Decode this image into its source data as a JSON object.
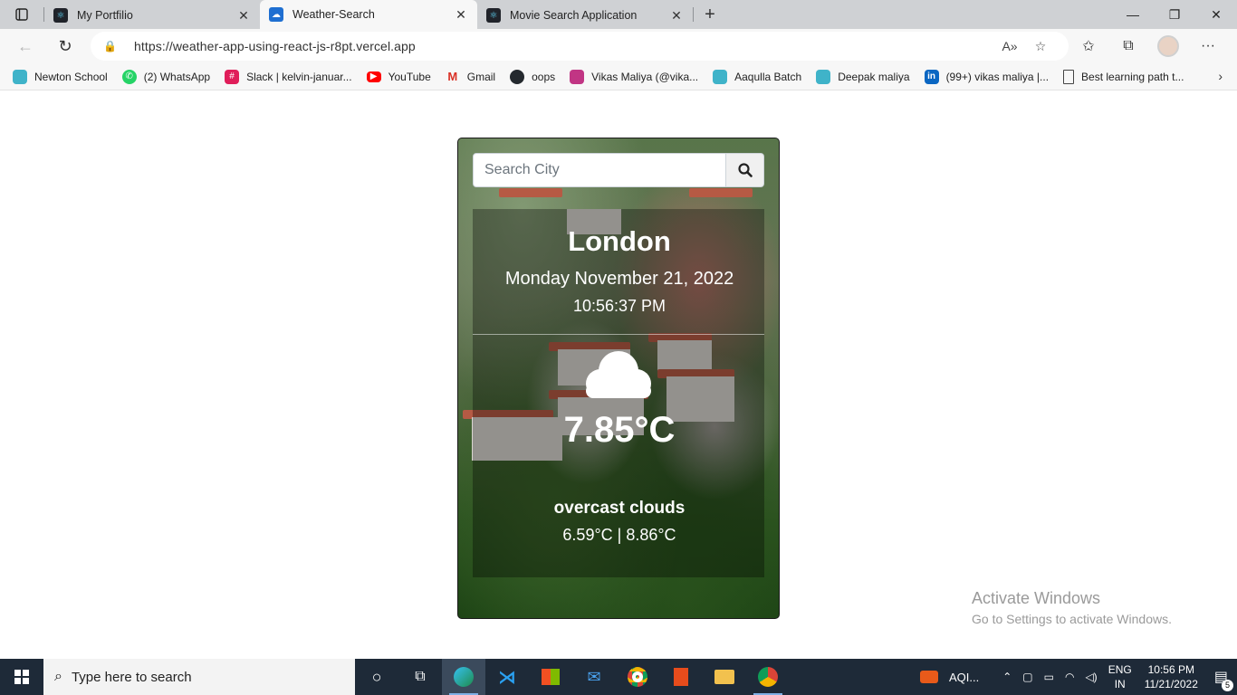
{
  "browser": {
    "tabs": [
      {
        "title": "My Portfilio",
        "active": false,
        "favicon_color": "#20232a"
      },
      {
        "title": "Weather-Search",
        "active": true,
        "favicon_color": "#1f6fd1"
      },
      {
        "title": "Movie Search Application",
        "active": false,
        "favicon_color": "#20232a"
      }
    ],
    "url": "https://weather-app-using-react-js-r8pt.vercel.app"
  },
  "bookmarks": [
    {
      "label": "Newton School",
      "icon": "newton-icon",
      "color": "#3fb3c9"
    },
    {
      "label": "(2) WhatsApp",
      "icon": "whatsapp-icon",
      "color": "#25d366"
    },
    {
      "label": "Slack | kelvin-januar...",
      "icon": "slack-icon",
      "color": "#e01e5a"
    },
    {
      "label": "YouTube",
      "icon": "youtube-icon",
      "color": "#ff0000"
    },
    {
      "label": "Gmail",
      "icon": "gmail-icon",
      "color": "#d93025"
    },
    {
      "label": "oops",
      "icon": "github-icon",
      "color": "#24292e"
    },
    {
      "label": "Vikas Maliya (@vika...",
      "icon": "instagram-icon",
      "color": "#c13584"
    },
    {
      "label": "Aaqulla Batch",
      "icon": "newton-icon",
      "color": "#3fb3c9"
    },
    {
      "label": "Deepak maliya",
      "icon": "newton-icon",
      "color": "#3fb3c9"
    },
    {
      "label": "(99+) vikas maliya |...",
      "icon": "linkedin-icon",
      "color": "#0a66c2"
    },
    {
      "label": "Best learning path t...",
      "icon": "page-icon",
      "color": "#ffffff"
    }
  ],
  "weather": {
    "search_placeholder": "Search City",
    "city": "London",
    "date": "Monday November 21, 2022",
    "time": "10:56:37 PM",
    "temperature": "7.85°C",
    "description": "overcast clouds",
    "min_max": "6.59°C | 8.86°C",
    "icon": "cloud-icon"
  },
  "watermark": {
    "line1": "Activate Windows",
    "line2": "Go to Settings to activate Windows."
  },
  "taskbar": {
    "search_placeholder": "Type here to search",
    "weather_label": "AQI...",
    "lang": "ENG",
    "region": "IN",
    "time": "10:56 PM",
    "date": "11/21/2022",
    "notifications": "5"
  }
}
